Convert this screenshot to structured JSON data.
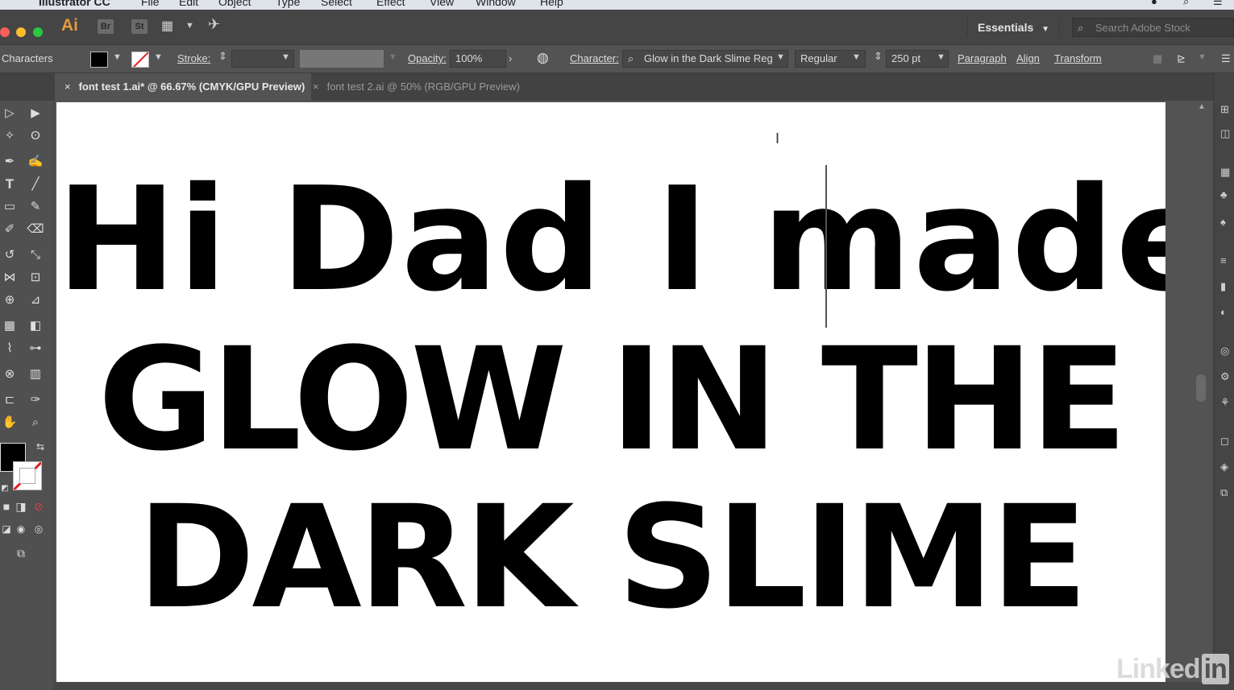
{
  "menubar": {
    "items": [
      "Illustrator CC",
      "File",
      "Edit",
      "Object",
      "Type",
      "Select",
      "Effect",
      "View",
      "Window",
      "Help"
    ]
  },
  "appbar": {
    "logo": "Ai",
    "bridge_label": "Br",
    "stock_label": "St",
    "workspace": "Essentials",
    "search_placeholder": "Search Adobe Stock",
    "traffic_colors": [
      "#fc5f57",
      "#fdbc2e",
      "#29c840"
    ]
  },
  "control_bar": {
    "panel_label": "Characters",
    "stroke_label": "Stroke:",
    "opacity_label": "Opacity:",
    "opacity_value": "100%",
    "character_label": "Character:",
    "font_family": "Glow in the Dark Slime Reg",
    "font_style": "Regular",
    "font_size": "250 pt",
    "paragraph_label": "Paragraph",
    "align_label": "Align",
    "transform_label": "Transform"
  },
  "tabs": [
    {
      "label": "font test 1.ai* @ 66.67% (CMYK/GPU Preview)",
      "active": true
    },
    {
      "label": "font test 2.ai @ 50% (RGB/GPU Preview)",
      "active": false
    }
  ],
  "artboard": {
    "lines": [
      "Hi Dad I made",
      "GLOW IN THE",
      "DARK SLIME"
    ]
  },
  "watermark": {
    "text": "Linked",
    "badge": "in"
  },
  "icons": {
    "close": "×",
    "caret": "⌄",
    "search": "⌕"
  }
}
